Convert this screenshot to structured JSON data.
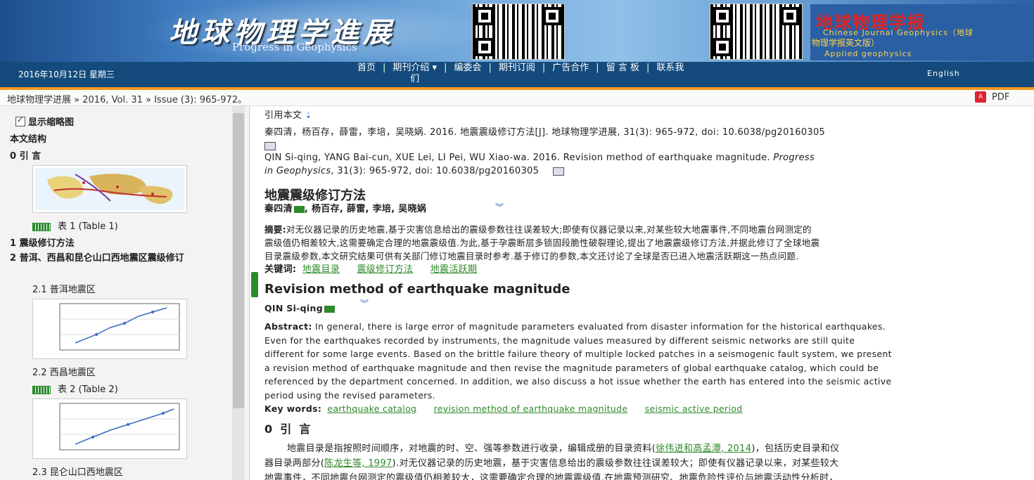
{
  "header": {
    "title": "地球物理学進展",
    "subtitle": "Progress in Geophysics",
    "cjg_title": "地球物理学报",
    "cjg_en": "Chinese Journal Geophysics（地球",
    "cjg_cn": "物理学报英文版）",
    "cjg_applied": "Applied geophysics"
  },
  "nav": {
    "date": "2016年10月12日  星期三",
    "items": [
      "首页",
      "期刊介绍 ▾\n们",
      "编委会",
      "期刊订阅",
      "广告合作",
      "留 言 板",
      "联系我"
    ],
    "english": "English"
  },
  "breadcrumb": {
    "journal": "地球物理学进展",
    "issue": "2016, Vol. 31",
    "pages": "Issue (3): 965-972",
    "pdf": "PDF"
  },
  "sidebar": {
    "show_thumbnails": "显示缩略图",
    "structure": "本文结构",
    "sec0": "0 引 言",
    "table1": "表 1 (Table 1)",
    "sec1": "1 震级修订方法",
    "sec2": "2 普洱、西昌和昆仑山口西地震区震级修订",
    "sec21": "2.1 普洱地震区",
    "sec22": "2.2 西昌地震区",
    "table2": "表 2 (Table 2)",
    "sec23": "2.3 昆仑山口西地震区"
  },
  "article": {
    "cite_label": "引用本文",
    "cite_cn": "秦四清，杨百存，薛雷，李培，吴晓娲. 2016. 地震震级修订方法[J]. 地球物理学进展, 31(3): 965-972, doi: 10.6038/pg20160305",
    "cite_en_1": "QIN Si-qing, YANG Bai-cun, XUE Lei, LI Pei, WU Xiao-wa. 2016. Revision method of earthquake magnitude. ",
    "cite_en_journal": "Progress",
    "cite_en_2": "in Geophysics",
    "cite_en_3": ", 31(3): 965-972, doi: 10.6038/pg20160305",
    "title_cn": "地震震级修订方法",
    "authors_cn": "秦四清",
    "authors_cn_rest": ", 杨百存, 薛雷, 李培, 吴晓娲",
    "abstract_cn_label": "摘要:",
    "abstract_cn_1": "对无仪器记录的历史地震,基于灾害信息给出的震级参数往往误差较大;即使有仪器记录以来,对某些较大地震事件,不同地震台网测定的",
    "abstract_cn_2": "震级值仍相差较大,这需要确定合理的地震震级值.为此,基于孕震断层多锁固段脆性破裂理论,提出了地震震级修订方法,并据此修订了全球地震",
    "abstract_cn_3": "目录震级参数,本文研究结果可供有关部门修订地震目录时参考.基于修订的参数,本文还讨论了全球是否已进入地震活跃期这一热点问题.",
    "keywords_cn_label": "关键词:",
    "keywords_cn": [
      "地震目录",
      "震级修订方法",
      "地震活跃期"
    ],
    "title_en": "Revision method of earthquake magnitude",
    "authors_en": "QIN Si-qing",
    "abstract_en_label": "Abstract:",
    "abstract_en_1": "In general, there is large error of magnitude parameters evaluated from disaster information for the historical earthquakes.",
    "abstract_en_2": "Even for the earthquakes recorded by instruments, the magnitude values measured by different seismic networks are still quite",
    "abstract_en_3": "different for some large events. Based on the brittle failure theory of multiple locked patches in a seismogenic fault system, we present",
    "abstract_en_4": "a revision method of earthquake magnitude and then revise the magnitude parameters of global earthquake catalog, which could be",
    "abstract_en_5": "referenced by the department concerned. In addition, we also discuss a hot issue whether the earth has entered into the seismic active",
    "abstract_en_6": "period using the revised parameters.",
    "keywords_en_label": "Key words:",
    "keywords_en": [
      "earthquake catalog",
      "revision method of earthquake magnitude",
      "seismic active period"
    ],
    "intro_heading": "0  引  言",
    "intro_1a": "地震目录是指按照时间顺序，对地震的时、空、强等参数进行收录，编辑成册的目录资料(",
    "intro_1link": "徐伟进和高孟潭, 2014",
    "intro_1b": ")，包括历史目录和仪",
    "intro_2a": "器目录两部分(",
    "intro_2link": "陈龙生等, 1997",
    "intro_2b": ").对无仪器记录的历史地震，基于灾害信息给出的震级参数往往误差较大；即使有仪器记录以来，对某些较大",
    "intro_3": "地震事件，不同地震台网测定的震级值仍相差较大，这需要确定合理的地震震级值.在地震预测研究、地震危险性评价与地震活动性分析时，"
  },
  "colors": {
    "nav_bg": "#144b7c",
    "accent_orange": "#f39a1e",
    "link_green": "#2f8a2a"
  }
}
